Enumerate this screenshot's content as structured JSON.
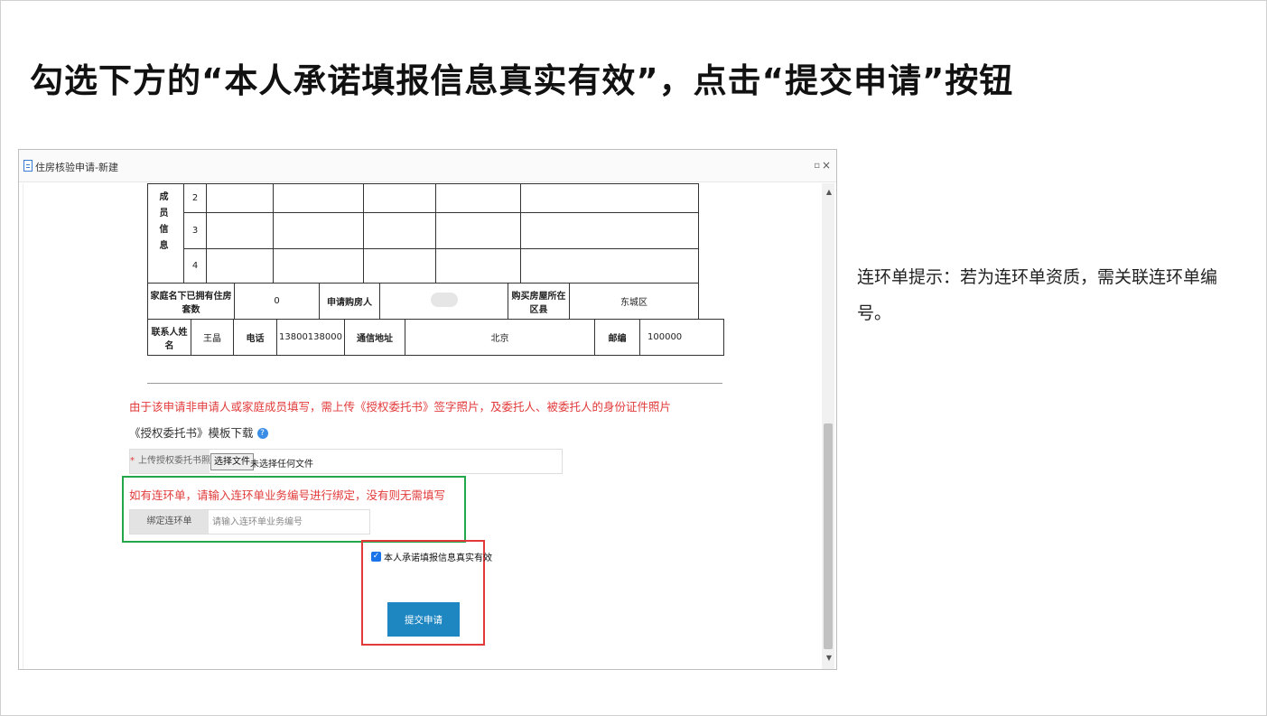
{
  "slide": {
    "title": "勾选下方的“本人承诺填报信息真实有效”，点击“提交申请”按钮",
    "note": "连环单提示：若为连环单资质，需关联连环单编号。"
  },
  "window": {
    "title": "住房核验申请-新建",
    "restore_glyph": "▫",
    "close_glyph": "×"
  },
  "form": {
    "member_label": "成 员 信 息",
    "member_rows": [
      "2",
      "3",
      "4"
    ],
    "house_count_label": "家庭名下已拥有住房套数",
    "house_count_value": "0",
    "buyer_label": "申请购房人",
    "district_label": "购买房屋所在区县",
    "district_value": "东城区",
    "contact_name_label": "联系人姓名",
    "contact_name_value": "王晶",
    "phone_label": "电话",
    "phone_value": "13800138000",
    "address_label": "通信地址",
    "address_value": "北京",
    "postcode_label": "邮编",
    "postcode_value": "100000"
  },
  "upload": {
    "warning": "由于该申请非申请人或家庭成员填写，需上传《授权委托书》签字照片，及委托人、被委托人的身份证件照片",
    "template_link": "《授权委托书》模板下载",
    "help_glyph": "?",
    "required_mark": "*",
    "label": "上传授权委托书照片",
    "choose_button": "选择文件",
    "file_status": "未选择任何文件"
  },
  "chain": {
    "hint": "如有连环单，请输入连环单业务编号进行绑定，没有则无需填写",
    "label": "绑定连环单",
    "placeholder": "请输入连环单业务编号"
  },
  "commit": {
    "checked": true,
    "check_glyph": "✓",
    "label": "本人承诺填报信息真实有效",
    "submit_label": "提交申请"
  },
  "colors": {
    "accent_green": "#22a84b",
    "accent_red": "#e23a3a",
    "submit_blue": "#1e87c2"
  }
}
